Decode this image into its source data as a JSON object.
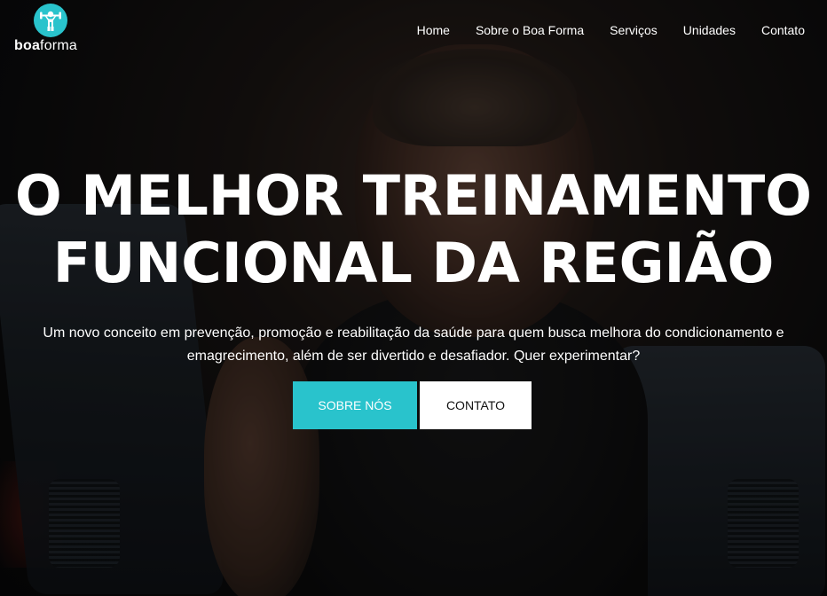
{
  "brand": {
    "name_bold": "boa",
    "name_light": "forma",
    "accent_color": "#29c3cc",
    "logo_icon": "weightlifter-icon"
  },
  "nav": {
    "items": [
      {
        "label": "Home"
      },
      {
        "label": "Sobre o Boa Forma"
      },
      {
        "label": "Serviços"
      },
      {
        "label": "Unidades"
      },
      {
        "label": "Contato"
      }
    ]
  },
  "hero": {
    "headline_line1": "O MELHOR TREINAMENTO",
    "headline_line2": "FUNCIONAL DA REGIÃO",
    "subtitle_line1": "Um novo conceito em prevenção, promoção e reabilitação da saúde para quem busca melhora do condicionamento e",
    "subtitle_line2": "emagrecimento, além de ser divertido e desafiador. Quer experimentar?",
    "primary_button": "SOBRE NÓS",
    "secondary_button": "CONTATO"
  }
}
